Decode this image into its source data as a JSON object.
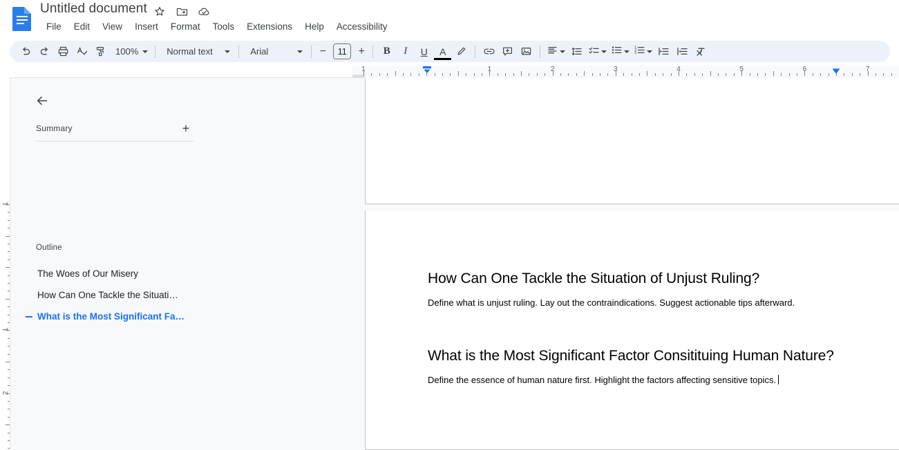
{
  "app": {
    "name": "Google Docs",
    "logo_icon": "google-docs-icon",
    "accent_color": "#1a73e8"
  },
  "titlebar": {
    "doc_title": "Untitled document",
    "icons": [
      {
        "name": "star-icon",
        "label": "Star"
      },
      {
        "name": "move-to-folder-icon",
        "label": "Move"
      },
      {
        "name": "cloud-saved-icon",
        "label": "Saved to Drive"
      }
    ]
  },
  "menubar": {
    "items": [
      {
        "label": "File"
      },
      {
        "label": "Edit"
      },
      {
        "label": "View"
      },
      {
        "label": "Insert"
      },
      {
        "label": "Format"
      },
      {
        "label": "Tools"
      },
      {
        "label": "Extensions"
      },
      {
        "label": "Help"
      },
      {
        "label": "Accessibility"
      }
    ]
  },
  "toolbar": {
    "undo_icon": "undo-icon",
    "redo_icon": "redo-icon",
    "print_icon": "print-icon",
    "spellcheck_icon": "spellcheck-icon",
    "paint_format_icon": "paint-format-icon",
    "zoom_value": "100%",
    "style_value": "Normal text",
    "font_value": "Arial",
    "font_size_decrease": "−",
    "font_size_value": "11",
    "font_size_increase": "+",
    "bold_label": "B",
    "italic_label": "I",
    "underline_label": "U",
    "text_color_label": "A",
    "highlight_icon": "highlight-pen-icon",
    "link_icon": "insert-link-icon",
    "comment_icon": "add-comment-icon",
    "image_icon": "insert-image-icon",
    "align_icon": "align-left-icon",
    "line_spacing_icon": "line-spacing-icon",
    "checklist_icon": "checklist-icon",
    "bulleted_list_icon": "bulleted-list-icon",
    "numbered_list_icon": "numbered-list-icon",
    "decrease_indent_icon": "decrease-indent-icon",
    "increase_indent_icon": "increase-indent-icon",
    "clear_formatting_icon": "clear-formatting-icon"
  },
  "ruler": {
    "horizontal_numbers": [
      "1",
      "1",
      "2",
      "3",
      "4",
      "5",
      "6",
      "7"
    ],
    "vertical_numbers": [
      "1",
      "1",
      "2"
    ],
    "left_indent_marker": "left-indent-marker",
    "right_indent_marker": "right-indent-marker"
  },
  "sidebar": {
    "back_icon": "back-arrow-icon",
    "summary": {
      "label": "Summary",
      "add_icon": "add-summary-icon"
    },
    "outline": {
      "label": "Outline",
      "items": [
        {
          "label": "The Woes of Our Misery",
          "active": false
        },
        {
          "label": "How Can One Tackle the Situati…",
          "active": false
        },
        {
          "label": "What is the Most Significant Fa…",
          "active": true
        }
      ]
    }
  },
  "document": {
    "blocks": [
      {
        "heading": "How Can One Tackle the Situation of Unjust Ruling?",
        "paragraph": "Define what is unjust ruling. Lay out the contraindications. Suggest actionable tips afterward."
      },
      {
        "heading": "What is the Most Significant Factor Consitituing Human Nature?",
        "paragraph": "Define the essence of human nature first. Highlight the factors affecting sensitive topics."
      }
    ]
  }
}
